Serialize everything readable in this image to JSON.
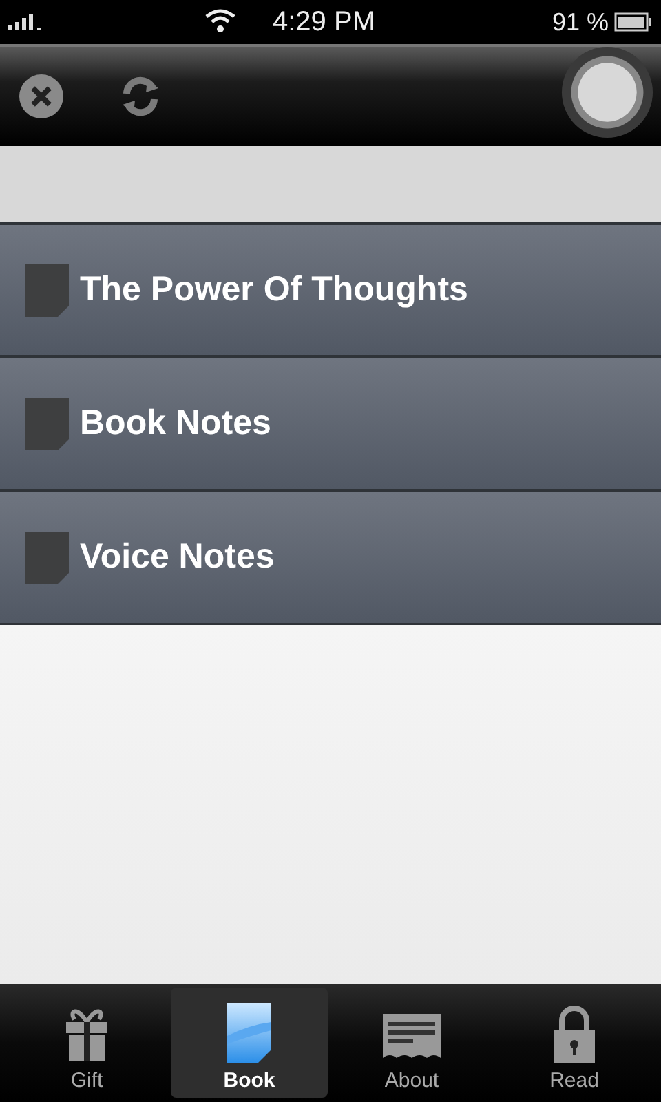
{
  "status_bar": {
    "time": "4:29 PM",
    "battery": "91 %"
  },
  "menu_items": [
    {
      "label": "The Power Of Thoughts"
    },
    {
      "label": "Book Notes"
    },
    {
      "label": "Voice Notes"
    }
  ],
  "tabs": [
    {
      "label": "Gift",
      "kind": "gift",
      "selected": false
    },
    {
      "label": "Book",
      "kind": "book",
      "selected": true
    },
    {
      "label": "About",
      "kind": "about",
      "selected": false
    },
    {
      "label": "Read",
      "kind": "read",
      "selected": false
    }
  ]
}
